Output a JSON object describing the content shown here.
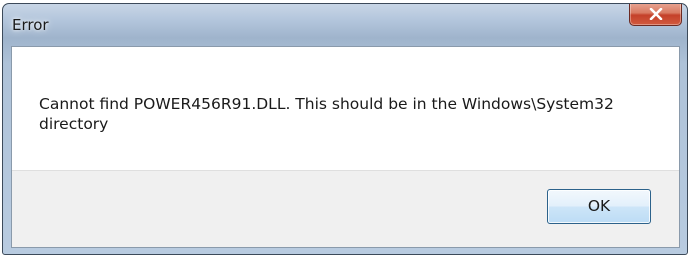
{
  "window": {
    "title": "Error"
  },
  "icons": {
    "close": "close-icon"
  },
  "dialog": {
    "message_line1": "Cannot find POWER456R91.DLL. This should be in the Windows\\System32",
    "message_line2": "directory",
    "ok_label": "OK"
  },
  "colors": {
    "close_button": "#c4412a",
    "ok_button_border": "#2c628b",
    "frame": "#b3c6dc"
  }
}
